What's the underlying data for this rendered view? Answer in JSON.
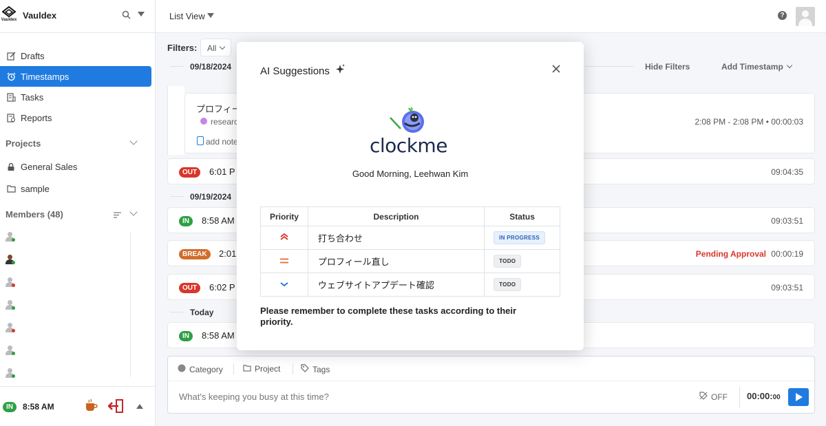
{
  "app": {
    "name": "Vauldex",
    "logo_caption": "Vauldex"
  },
  "header": {
    "view_label": "List View"
  },
  "sidebar": {
    "nav": [
      {
        "label": "Drafts",
        "icon": "edit-icon"
      },
      {
        "label": "Timestamps",
        "icon": "alarm-clock-icon"
      },
      {
        "label": "Tasks",
        "icon": "tasks-icon"
      },
      {
        "label": "Reports",
        "icon": "report-icon"
      }
    ],
    "projects_title": "Projects",
    "projects": [
      {
        "label": "General Sales",
        "icon": "lock-icon"
      },
      {
        "label": "sample",
        "icon": "folder-icon"
      }
    ],
    "members_title": "Members (48)",
    "members_status_colors": [
      "#2ea043",
      "#2ea043",
      "#d9362b",
      "#2ea043",
      "#d9362b",
      "#2ea043",
      "#2ea043"
    ],
    "footer": {
      "status": "IN",
      "time": "8:58 AM"
    }
  },
  "main": {
    "filters_label": "Filters:",
    "filter_value": "All",
    "hide_filters": "Hide Filters",
    "add_timestamp": "Add Timestamp",
    "dates": [
      "09/18/2024",
      "09/19/2024",
      "Today"
    ],
    "detail": {
      "title": "プロフィー",
      "tag": "researc",
      "note": "add note",
      "range": "2:08 PM -   2:08 PM • 00:00:03"
    },
    "entries": [
      {
        "badge": "OUT",
        "time": "6:01 P",
        "duration": "09:04:35"
      },
      {
        "badge": "IN",
        "time": "8:58 AM",
        "duration": "09:03:51"
      },
      {
        "badge": "BREAK",
        "time": "2:01",
        "duration": "00:00:19",
        "status": "Pending Approval"
      },
      {
        "badge": "OUT",
        "time": "6:02 P",
        "duration": "09:03:51"
      },
      {
        "badge": "IN",
        "time": "8:58 AM",
        "duration": ""
      }
    ]
  },
  "composer": {
    "category": "Category",
    "project": "Project",
    "tags": "Tags",
    "placeholder": "What's keeping you busy at this time?",
    "billable": "OFF",
    "timer_main": "00:00:",
    "timer_sec": "00"
  },
  "modal": {
    "title": "AI Suggestions",
    "logo_text": "clockme",
    "greeting": "Good Morning, Leehwan Kim",
    "columns": {
      "priority": "Priority",
      "description": "Description",
      "status": "Status"
    },
    "tasks": [
      {
        "priority": "high",
        "priority_color": "#d9362b",
        "description": "打ち合わせ",
        "status": "IN PROGRESS"
      },
      {
        "priority": "medium",
        "priority_color": "#e8663d",
        "description": "プロフィール直し",
        "status": "TODO"
      },
      {
        "priority": "low",
        "priority_color": "#1f7be0",
        "description": "ウェブサイトアプデート確認",
        "status": "TODO"
      }
    ],
    "note": "Please remember to complete these tasks according to their priority."
  }
}
